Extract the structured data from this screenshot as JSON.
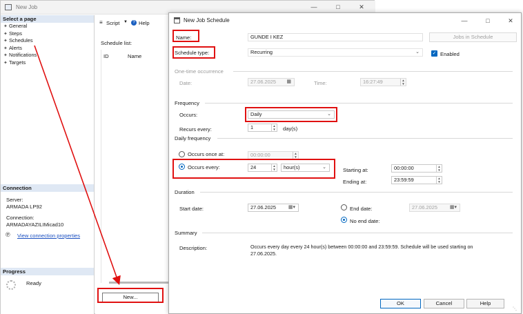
{
  "bg_window": {
    "title": "New Job",
    "left_pane": {
      "select_page_header": "Select a page",
      "pages": [
        "General",
        "Steps",
        "Schedules",
        "Alerts",
        "Notifications",
        "Targets"
      ],
      "connection_header": "Connection",
      "server_label": "Server:",
      "server_value": "ARMADA LP92",
      "connection_label": "Connection:",
      "connection_value": "ARMADAYAZILIMicad10",
      "view_connection_link": "View connection properties",
      "progress_header": "Progress",
      "progress_status": "Ready"
    },
    "toolbar": {
      "script_label": "Script",
      "help_label": "Help"
    },
    "schedule_list_label": "Schedule list:",
    "columns": [
      "ID",
      "Name"
    ],
    "new_button_label": "New..."
  },
  "dialog": {
    "title": "New Job Schedule",
    "name_label": "Name:",
    "name_value": "GUNDE I KEZ",
    "jobs_in_schedule_label": "Jobs in Schedule",
    "schedule_type_label": "Schedule type:",
    "schedule_type_value": "Recurring",
    "enabled_label": "Enabled",
    "one_time": {
      "header": "One-time occurrence",
      "date_label": "Date:",
      "date_value": "27.06.2025",
      "time_label": "Time:",
      "time_value": "16:27:49"
    },
    "frequency": {
      "header": "Frequency",
      "occurs_label": "Occurs:",
      "occurs_value": "Daily",
      "recurs_label": "Recurs every:",
      "recurs_value": "1",
      "recurs_unit": "day(s)"
    },
    "daily_frequency": {
      "header": "Daily frequency",
      "once_label": "Occurs once at:",
      "once_value": "00:00:00",
      "every_label": "Occurs every:",
      "every_value": "24",
      "every_unit": "hour(s)",
      "starting_label": "Starting at:",
      "starting_value": "00:00:00",
      "ending_label": "Ending at:",
      "ending_value": "23:59:59"
    },
    "duration": {
      "header": "Duration",
      "start_label": "Start date:",
      "start_value": "27.06.2025",
      "end_label": "End date:",
      "end_value": "27.06.2025",
      "no_end_label": "No end date:"
    },
    "summary": {
      "header": "Summary",
      "description_label": "Description:",
      "description_value": "Occurs every day every 24 hour(s) between 00:00:00 and 23:59:59. Schedule will be used starting on 27.06.2025."
    },
    "buttons": {
      "ok": "OK",
      "cancel": "Cancel",
      "help": "Help"
    }
  },
  "colors": {
    "highlight_red": "#e01010",
    "accent_blue": "#0067c0",
    "pane_header_bg": "#dfe8f4"
  }
}
